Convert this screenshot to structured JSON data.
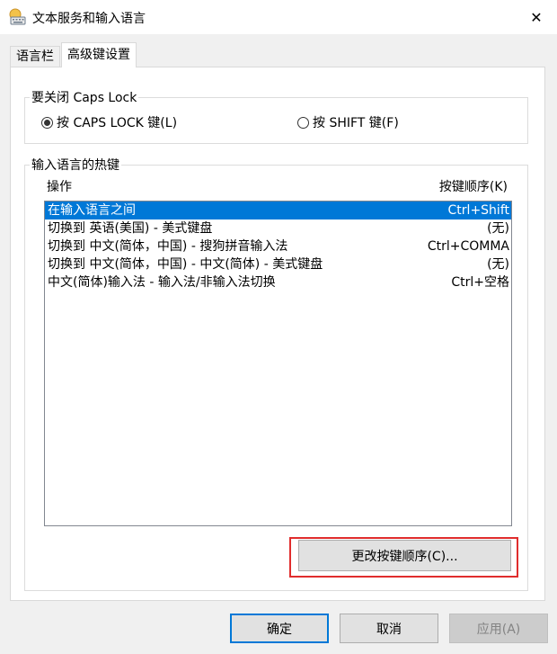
{
  "window": {
    "title": "文本服务和输入语言",
    "icon": "keyboard-language-icon",
    "close_glyph": "✕"
  },
  "tabs": [
    {
      "label": "语言栏",
      "active": false
    },
    {
      "label": "高级键设置",
      "active": true
    }
  ],
  "caps_lock_group": {
    "label": "要关闭 Caps Lock",
    "options": [
      {
        "label": "按 CAPS LOCK 键(L)",
        "checked": true
      },
      {
        "label": "按 SHIFT 键(F)",
        "checked": false
      }
    ]
  },
  "hotkeys_group": {
    "label": "输入语言的热键",
    "col_action": "操作",
    "col_key": "按键顺序(K)",
    "rows": [
      {
        "action": "在输入语言之间",
        "key": "Ctrl+Shift",
        "selected": true
      },
      {
        "action": "切换到 英语(美国) - 美式键盘",
        "key": "(无)",
        "selected": false
      },
      {
        "action": "切换到 中文(简体，中国) - 搜狗拼音输入法",
        "key": "Ctrl+COMMA",
        "selected": false
      },
      {
        "action": "切换到 中文(简体，中国) - 中文(简体) - 美式键盘",
        "key": "(无)",
        "selected": false
      },
      {
        "action": "中文(简体)输入法 - 输入法/非输入法切换",
        "key": "Ctrl+空格",
        "selected": false
      }
    ],
    "change_button": "更改按键顺序(C)..."
  },
  "footer": {
    "ok": "确定",
    "cancel": "取消",
    "apply": "应用(A)"
  },
  "colors": {
    "selection": "#0078d7",
    "highlight_box": "#e02d2d",
    "dialog_bg": "#f0f0f0"
  }
}
